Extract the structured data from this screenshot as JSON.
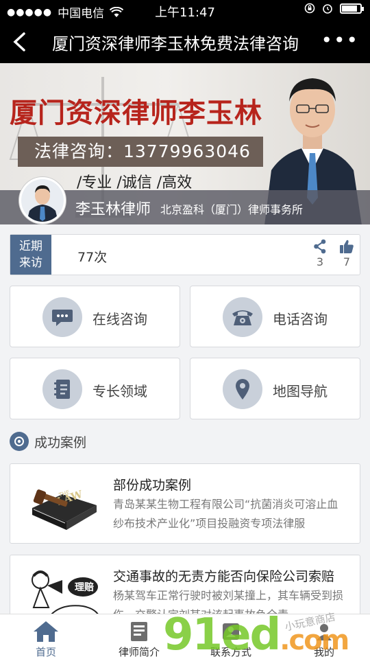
{
  "status_bar": {
    "carrier": "中国电信",
    "time": "上午11:47"
  },
  "nav": {
    "back": "<",
    "title": "厦门资深律师李玉林免费法律咨询",
    "more": "•••"
  },
  "banner": {
    "headline": "厦门资深律师李玉林",
    "consult_line": "法律咨询：13779963046",
    "motto": "/专业  /诚信  /高效",
    "lawyer_name": "李玉林律师",
    "firm": "北京盈科（厦门）律师事务所"
  },
  "visits": {
    "label_line1": "近期",
    "label_line2": "来访",
    "count": "77次",
    "shares": "3",
    "likes": "7"
  },
  "features": [
    {
      "label": "在线咨询",
      "icon": "chat-icon"
    },
    {
      "label": "电话咨询",
      "icon": "telephone-icon"
    },
    {
      "label": "专长领域",
      "icon": "notebook-icon"
    },
    {
      "label": "地图导航",
      "icon": "map-pin-icon"
    }
  ],
  "section": {
    "title": "成功案例"
  },
  "cases": [
    {
      "title": "部份成功案例",
      "desc": "青岛某某生物工程有限公司“抗菌消炎可溶止血纱布技术产业化”项目投融资专项法律服",
      "thumb_text": "LAW",
      "thumb_small": "THE"
    },
    {
      "title": "交通事故的无责方能否向保险公司索赔",
      "desc": "杨某驾车正常行驶时被刘某撞上，其车辆受到损伤，交警认定刘某对该起事故负全责",
      "thumb_text": "理赔"
    }
  ],
  "tabbar": [
    {
      "label": "首页",
      "icon": "home-icon"
    },
    {
      "label": "律师简介",
      "icon": "profile-icon"
    },
    {
      "label": "联系方式",
      "icon": "contact-icon"
    },
    {
      "label": "我的",
      "icon": "user-icon"
    }
  ],
  "watermark": {
    "brand_num": "91",
    "brand_ed": "ed",
    "brand_com": ".com",
    "script_text": "小玩意商店"
  },
  "colors": {
    "accent": "#4f6b8f",
    "headline_red": "#b7241c",
    "icon_circle": "#c9d0da"
  }
}
